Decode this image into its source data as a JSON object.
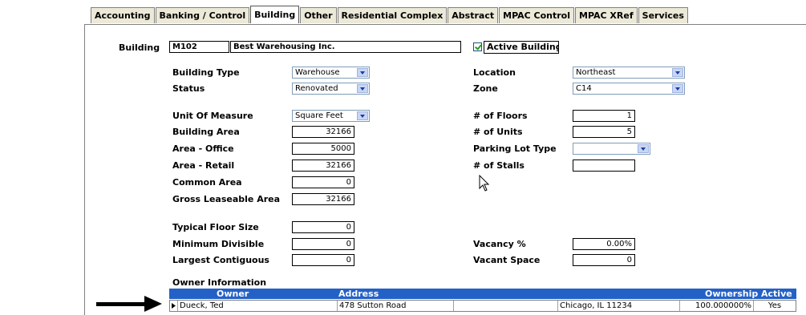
{
  "tabs": [
    {
      "label": "Accounting",
      "active": false
    },
    {
      "label": "Banking / Control",
      "active": false
    },
    {
      "label": "Building",
      "active": true
    },
    {
      "label": "Other",
      "active": false
    },
    {
      "label": "Residential Complex",
      "active": false
    },
    {
      "label": "Abstract",
      "active": false
    },
    {
      "label": "MPAC Control",
      "active": false
    },
    {
      "label": "MPAC XRef",
      "active": false
    },
    {
      "label": "Services",
      "active": false
    }
  ],
  "building": {
    "label": "Building",
    "code": "M102",
    "name": "Best Warehousing Inc.",
    "active_label": "Active Building",
    "active": true
  },
  "fields": {
    "building_type": {
      "label": "Building Type",
      "value": "Warehouse"
    },
    "status": {
      "label": "Status",
      "value": "Renovated"
    },
    "location": {
      "label": "Location",
      "value": "Northeast"
    },
    "zone": {
      "label": "Zone",
      "value": "C14"
    },
    "unit_of_measure": {
      "label": "Unit Of Measure",
      "value": "Square Feet"
    },
    "building_area": {
      "label": "Building Area",
      "value": "32166"
    },
    "area_office": {
      "label": "Area - Office",
      "value": "5000"
    },
    "area_retail": {
      "label": "Area - Retail",
      "value": "32166"
    },
    "common_area": {
      "label": "Common Area",
      "value": "0"
    },
    "gross_leaseable_area": {
      "label": "Gross Leaseable Area",
      "value": "32166"
    },
    "num_floors": {
      "label": "# of Floors",
      "value": "1"
    },
    "num_units": {
      "label": "# of Units",
      "value": "5"
    },
    "parking_lot_type": {
      "label": "Parking Lot Type",
      "value": ""
    },
    "num_stalls": {
      "label": "# of Stalls",
      "value": ""
    },
    "typical_floor_size": {
      "label": "Typical Floor Size",
      "value": "0"
    },
    "minimum_divisible": {
      "label": "Minimum Divisible",
      "value": "0"
    },
    "largest_contiguous": {
      "label": "Largest Contiguous",
      "value": "0"
    },
    "vacancy_pct": {
      "label": "Vacancy %",
      "value": "0.00%"
    },
    "vacant_space": {
      "label": "Vacant Space",
      "value": "0"
    }
  },
  "owner_info": {
    "title": "Owner Information",
    "headers": {
      "owner": "Owner",
      "address": "Address",
      "ownership": "Ownership",
      "active": "Active"
    },
    "rows": [
      {
        "owner": "Dueck, Ted",
        "address": "478 Sutton Road",
        "address2": "",
        "city": "Chicago, IL  11234",
        "ownership": "100.000000%",
        "active": "Yes"
      }
    ]
  },
  "colors": {
    "grid_header": "#2461c6",
    "tab_bg": "#ece9d8",
    "check": "#21a121"
  }
}
